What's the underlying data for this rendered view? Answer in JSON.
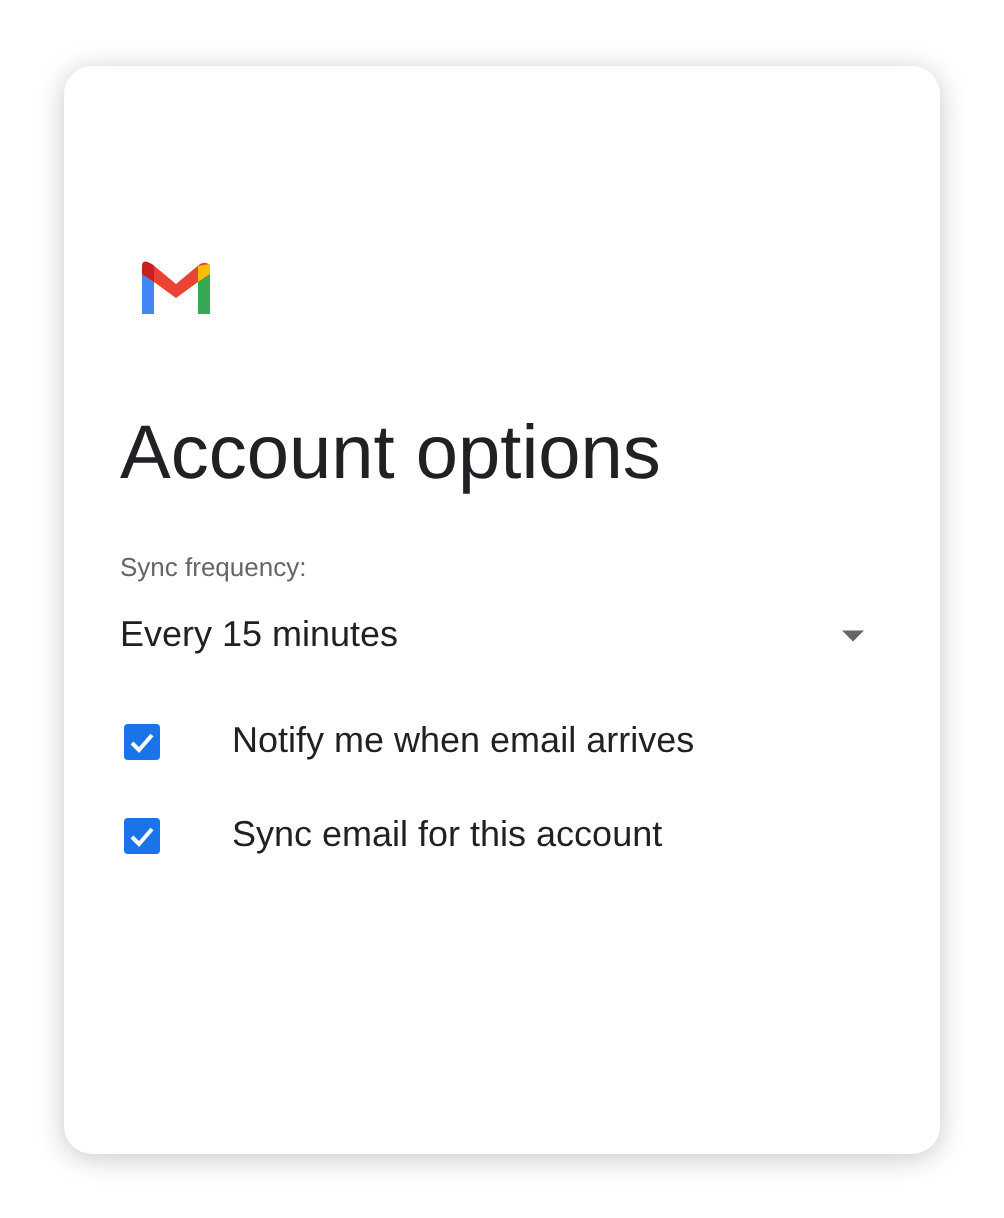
{
  "title": "Account options",
  "sync_frequency": {
    "label": "Sync frequency:",
    "value": "Every 15 minutes"
  },
  "options": [
    {
      "label": "Notify me when email arrives",
      "checked": true
    },
    {
      "label": "Sync email for this account",
      "checked": true
    }
  ]
}
